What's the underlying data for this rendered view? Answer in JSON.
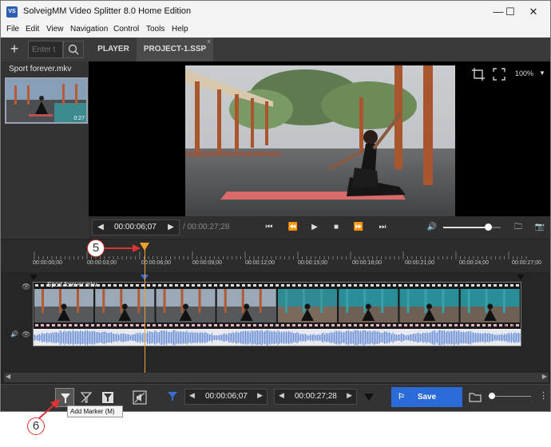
{
  "window": {
    "title": "SolveigMM Video Splitter 8.0 Home Edition",
    "logo_text": "VS",
    "minimize": "—",
    "maximize": "☐",
    "close": "✕"
  },
  "menu": [
    "File",
    "Edit",
    "View",
    "Navigation",
    "Control",
    "Tools",
    "Help"
  ],
  "toolbar": {
    "add_label": "+",
    "search_placeholder": "Enter t",
    "tabs": [
      {
        "label": "PLAYER"
      },
      {
        "label": "PROJECT-1.SSP"
      }
    ],
    "tab_close": "×"
  },
  "file_panel": {
    "file_name": "Sport forever.mkv",
    "thumb_duration": "0:27"
  },
  "player": {
    "zoom": "100%",
    "current_time": "00:00:06;07",
    "duration": "/ 00:00:27;28",
    "volume_level": 0.78
  },
  "timeline": {
    "ticks": [
      "00:00:00;00",
      "00:00:03;00",
      "00:00:06;00",
      "00:00:09;00",
      "00:00:12;00",
      "00:00:15;00",
      "00:00:18;00",
      "00:00:21;00",
      "00:00:24;00",
      "00:00:27;00"
    ],
    "track_name": "Sport forever.mkv",
    "track_duration": "0:27"
  },
  "bottom": {
    "marker_in_time": "00:00:06;07",
    "marker_out_time": "00:00:27;28",
    "save_label": "Save",
    "tooltip": "Add Marker (M)"
  },
  "annotations": {
    "callout_playhead": "5",
    "callout_add_marker": "6",
    "color": "#d33333"
  },
  "colors": {
    "accent": "#2b6ad9",
    "playhead": "#f0a030",
    "waveform": "#6f93d8"
  }
}
